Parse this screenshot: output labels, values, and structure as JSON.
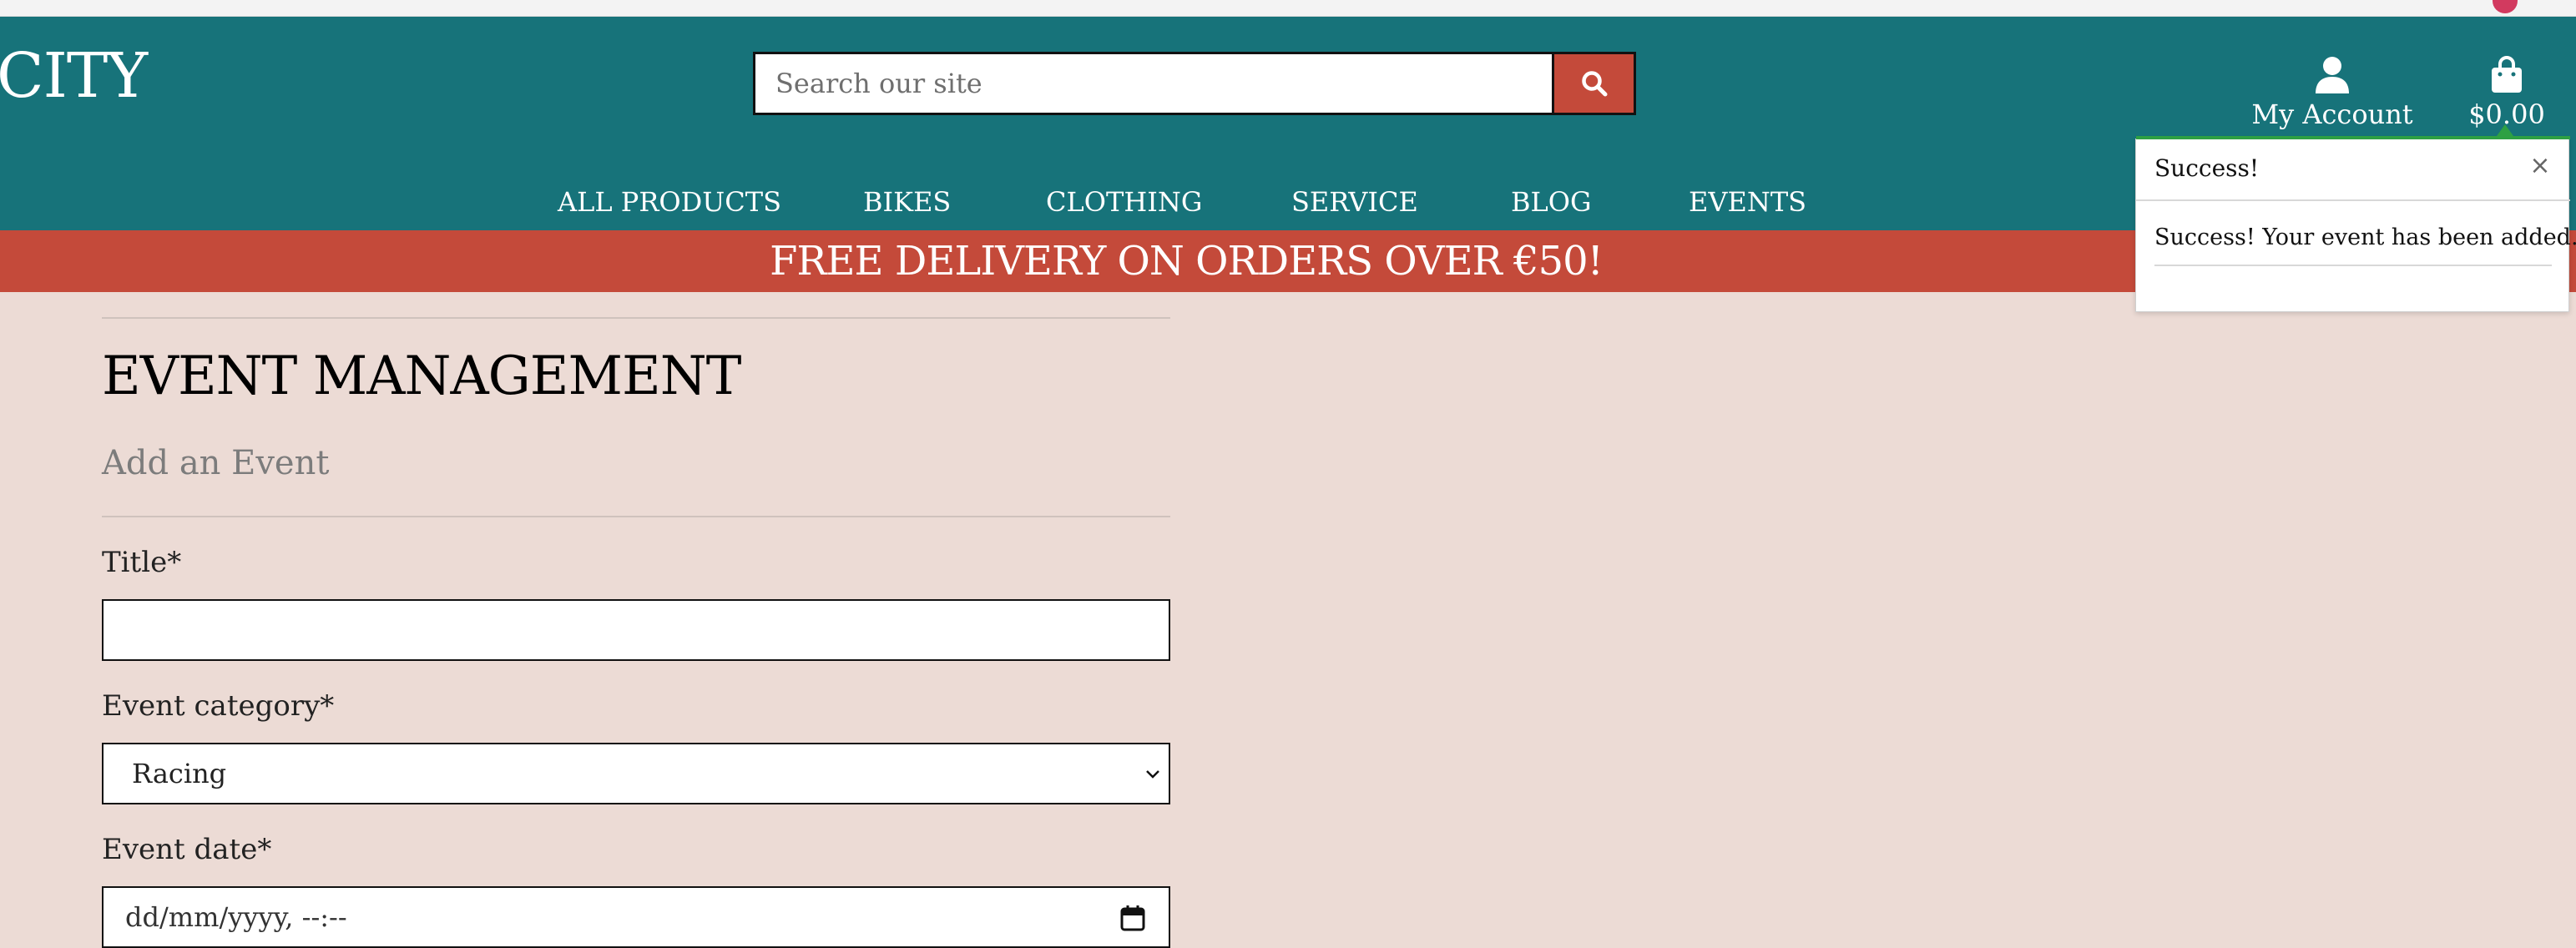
{
  "header": {
    "logo_text": "CITY",
    "search": {
      "placeholder": "Search our site",
      "value": ""
    },
    "account_label": "My Account",
    "cart_total": "$0.00"
  },
  "nav": {
    "items": [
      {
        "label": "ALL PRODUCTS"
      },
      {
        "label": "BIKES"
      },
      {
        "label": "CLOTHING"
      },
      {
        "label": "SERVICE"
      },
      {
        "label": "BLOG"
      },
      {
        "label": "EVENTS"
      }
    ]
  },
  "banner": {
    "text": "FREE DELIVERY ON ORDERS OVER €50!"
  },
  "page": {
    "title": "EVENT MANAGEMENT",
    "subtitle": "Add an Event"
  },
  "form": {
    "title_label": "Title*",
    "title_value": "",
    "category_label": "Event category*",
    "category_value": "Racing",
    "date_label": "Event date*",
    "date_placeholder": "dd/mm/yyyy, --:--"
  },
  "toast": {
    "title": "Success!",
    "close_symbol": "×",
    "message": "Success! Your event has been added.",
    "accent_color": "#2ea043"
  },
  "colors": {
    "header_bg": "#17737a",
    "banner_bg": "#c44a3a",
    "page_bg": "#ecdbd5"
  },
  "icons": {
    "search": "search-icon",
    "account": "user-icon",
    "cart": "shopping-bag-icon",
    "select": "chevron-down-icon",
    "date": "calendar-icon",
    "close": "close-icon"
  }
}
